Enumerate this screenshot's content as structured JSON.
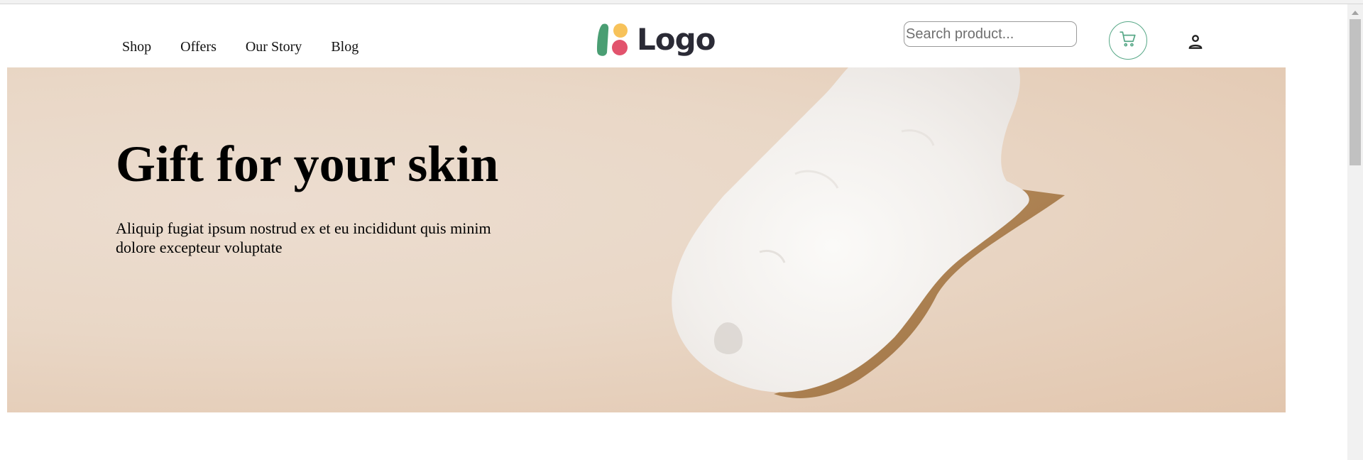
{
  "nav": {
    "links": [
      "Shop",
      "Offers",
      "Our Story",
      "Blog"
    ]
  },
  "logo": {
    "text": "Logo",
    "colors": {
      "green": "#4a9e73",
      "yellow": "#f7c25a",
      "pink": "#e2536d"
    }
  },
  "search": {
    "placeholder": "Search product...",
    "value": ""
  },
  "icons": {
    "cart": "shopping-cart-icon",
    "user": "user-icon"
  },
  "hero": {
    "title": "Gift for your skin",
    "subtitle": "Aliquip fugiat ipsum nostrud ex et eu incididunt quis minim dolore excepteur voluptate"
  },
  "colors": {
    "accent": "#57a887",
    "hero_bg": "#e9d7c6"
  }
}
